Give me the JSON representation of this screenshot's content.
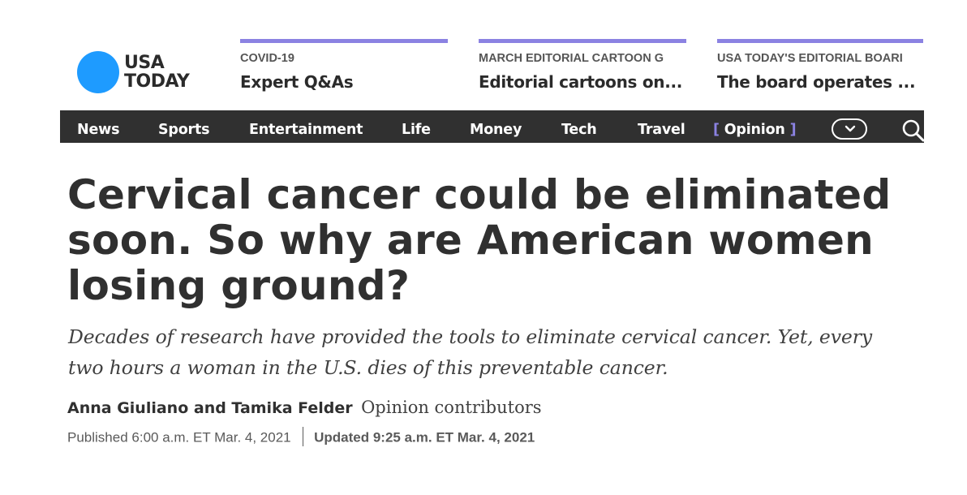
{
  "logo": {
    "line1": "USA",
    "line2": "TODAY"
  },
  "promos": [
    {
      "kicker": "COVID-19",
      "title": "Expert Q&As"
    },
    {
      "kicker": "MARCH EDITORIAL CARTOON G",
      "title": "Editorial cartoons on..."
    },
    {
      "kicker": "USA TODAY'S EDITORIAL BOARI",
      "title": "The board operates ..."
    }
  ],
  "nav": {
    "items": [
      "News",
      "Sports",
      "Entertainment",
      "Life",
      "Money",
      "Tech",
      "Travel"
    ],
    "active": {
      "open_bracket": "[",
      "label": "Opinion",
      "close_bracket": "]"
    },
    "icons": {
      "more": "chevron-down-icon",
      "search": "search-icon"
    }
  },
  "article": {
    "headline": "Cervical cancer could be eliminated soon. So why are American women losing ground?",
    "subhead": "Decades of research have provided the tools to eliminate cervical cancer. Yet, every two hours a woman in the U.S. dies of this preventable cancer.",
    "authors": "Anna Giuliano and Tamika Felder",
    "role": "Opinion contributors",
    "published": "Published 6:00 a.m. ET Mar. 4, 2021",
    "updated": "Updated 9:25 a.m. ET Mar. 4, 2021"
  },
  "colors": {
    "brand_blue": "#1e9bff",
    "accent_purple": "#8b82e2",
    "nav_bg": "#303030"
  }
}
